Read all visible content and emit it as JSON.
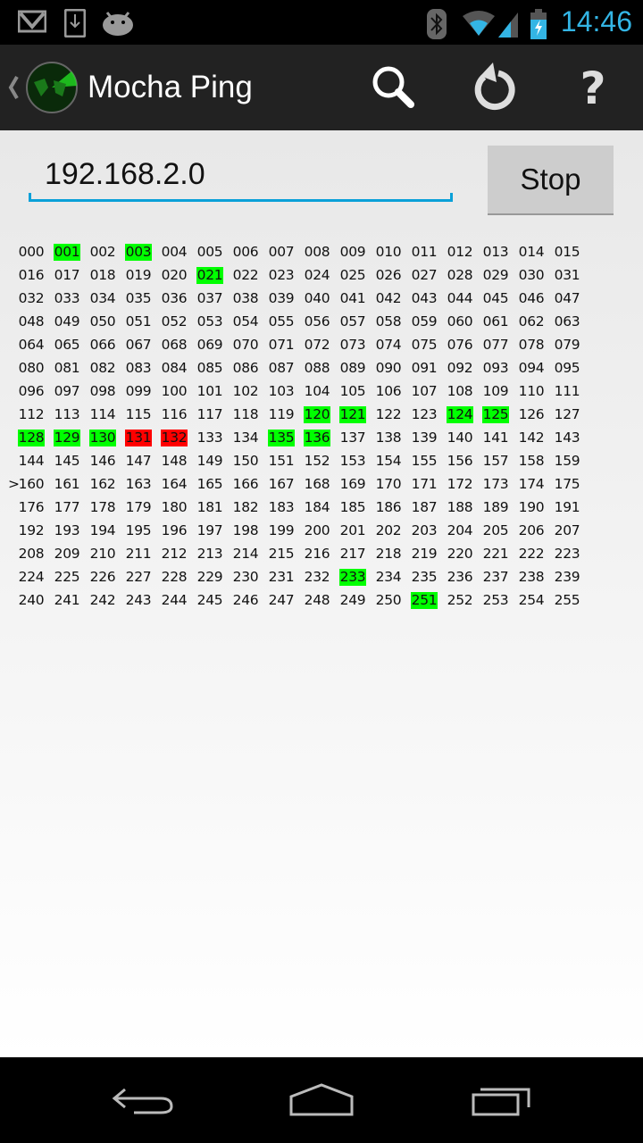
{
  "status_bar": {
    "time": "14:46",
    "icons": [
      "gmail-icon",
      "download-icon",
      "android-icon",
      "bluetooth-icon",
      "wifi-icon",
      "signal-icon",
      "battery-charging-icon"
    ]
  },
  "action_bar": {
    "title": "Mocha Ping",
    "icons": [
      "radar-logo-icon",
      "search-icon",
      "refresh-icon",
      "help-icon"
    ]
  },
  "form": {
    "ip_value": "192.168.2.0",
    "stop_label": "Stop",
    "accent": "#33b5e5"
  },
  "grid": {
    "current": 160,
    "current_marker": ">",
    "green": [
      1,
      3,
      21,
      120,
      121,
      124,
      125,
      128,
      129,
      130,
      135,
      136,
      233,
      251
    ],
    "red": [
      131,
      132
    ],
    "colors": {
      "green": "#00ff00",
      "red": "#ff0000"
    },
    "rows": [
      [
        "000",
        "001",
        "002",
        "003",
        "004",
        "005",
        "006",
        "007",
        "008",
        "009",
        "010",
        "011",
        "012",
        "013",
        "014",
        "015"
      ],
      [
        "016",
        "017",
        "018",
        "019",
        "020",
        "021",
        "022",
        "023",
        "024",
        "025",
        "026",
        "027",
        "028",
        "029",
        "030",
        "031"
      ],
      [
        "032",
        "033",
        "034",
        "035",
        "036",
        "037",
        "038",
        "039",
        "040",
        "041",
        "042",
        "043",
        "044",
        "045",
        "046",
        "047"
      ],
      [
        "048",
        "049",
        "050",
        "051",
        "052",
        "053",
        "054",
        "055",
        "056",
        "057",
        "058",
        "059",
        "060",
        "061",
        "062",
        "063"
      ],
      [
        "064",
        "065",
        "066",
        "067",
        "068",
        "069",
        "070",
        "071",
        "072",
        "073",
        "074",
        "075",
        "076",
        "077",
        "078",
        "079"
      ],
      [
        "080",
        "081",
        "082",
        "083",
        "084",
        "085",
        "086",
        "087",
        "088",
        "089",
        "090",
        "091",
        "092",
        "093",
        "094",
        "095"
      ],
      [
        "096",
        "097",
        "098",
        "099",
        "100",
        "101",
        "102",
        "103",
        "104",
        "105",
        "106",
        "107",
        "108",
        "109",
        "110",
        "111"
      ],
      [
        "112",
        "113",
        "114",
        "115",
        "116",
        "117",
        "118",
        "119",
        "120",
        "121",
        "122",
        "123",
        "124",
        "125",
        "126",
        "127"
      ],
      [
        "128",
        "129",
        "130",
        "131",
        "132",
        "133",
        "134",
        "135",
        "136",
        "137",
        "138",
        "139",
        "140",
        "141",
        "142",
        "143"
      ],
      [
        "144",
        "145",
        "146",
        "147",
        "148",
        "149",
        "150",
        "151",
        "152",
        "153",
        "154",
        "155",
        "156",
        "157",
        "158",
        "159"
      ],
      [
        "160",
        "161",
        "162",
        "163",
        "164",
        "165",
        "166",
        "167",
        "168",
        "169",
        "170",
        "171",
        "172",
        "173",
        "174",
        "175"
      ],
      [
        "176",
        "177",
        "178",
        "179",
        "180",
        "181",
        "182",
        "183",
        "184",
        "185",
        "186",
        "187",
        "188",
        "189",
        "190",
        "191"
      ],
      [
        "192",
        "193",
        "194",
        "195",
        "196",
        "197",
        "198",
        "199",
        "200",
        "201",
        "202",
        "203",
        "204",
        "205",
        "206",
        "207"
      ],
      [
        "208",
        "209",
        "210",
        "211",
        "212",
        "213",
        "214",
        "215",
        "216",
        "217",
        "218",
        "219",
        "220",
        "221",
        "222",
        "223"
      ],
      [
        "224",
        "225",
        "226",
        "227",
        "228",
        "229",
        "230",
        "231",
        "232",
        "233",
        "234",
        "235",
        "236",
        "237",
        "238",
        "239"
      ],
      [
        "240",
        "241",
        "242",
        "243",
        "244",
        "245",
        "246",
        "247",
        "248",
        "249",
        "250",
        "251",
        "252",
        "253",
        "254",
        "255"
      ]
    ]
  },
  "nav_bar": {
    "icons": [
      "back-icon",
      "home-icon",
      "recent-apps-icon"
    ]
  }
}
